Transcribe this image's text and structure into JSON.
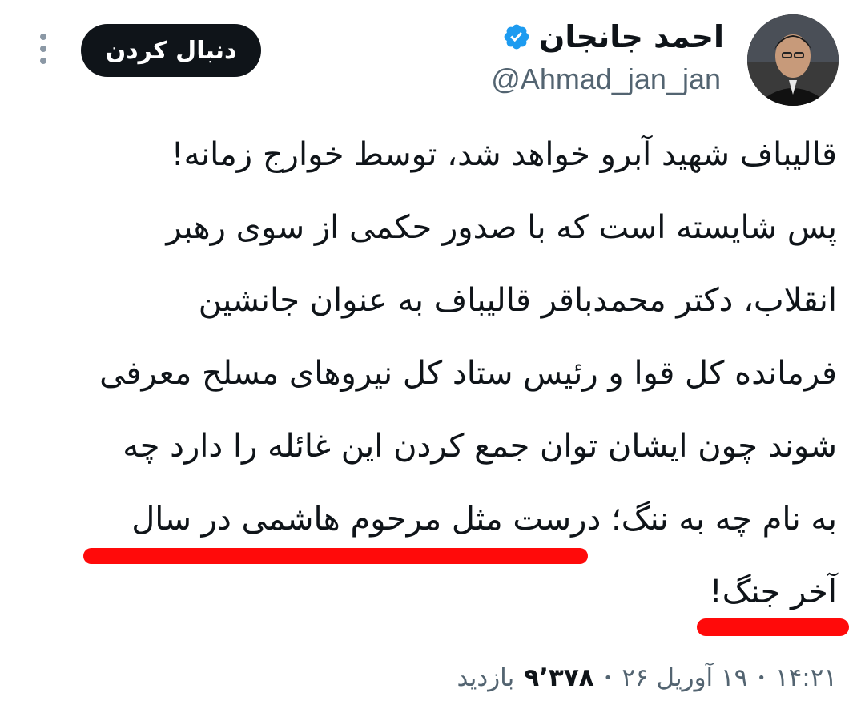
{
  "author": {
    "display_name": "احمد جانجان",
    "handle": "@Ahmad_jan_jan",
    "verified_icon": "verified-badge-icon",
    "verified_color": "#1d9bf0"
  },
  "actions": {
    "follow_label": "دنبال کردن",
    "more_icon": "more-vertical-icon"
  },
  "tweet": {
    "lines": [
      "قالیباف شهید آبرو خواهد شد، توسط خوارج زمانه!",
      "پس شایسته است که با صدور حکمی از سوی رهبر",
      "انقلاب، دکتر محمدباقر قالیباف به عنوان جانشین",
      "فرمانده کل قوا و رئیس ستاد کل نیروهای مسلح معرفی",
      "شوند چون ایشان توان جمع کردن این غائله را دارد چه",
      "به نام چه به ننگ؛ درست مثل مرحوم هاشمی در سال",
      "آخر جنگ!"
    ],
    "highlight_color": "#ff0a0a"
  },
  "meta": {
    "time": "۱۴:۲۱",
    "date": "۱۹ آوریل ۲۶",
    "views_count": "۹٬۳۷۸",
    "views_label": "بازدید",
    "separator": "•"
  }
}
